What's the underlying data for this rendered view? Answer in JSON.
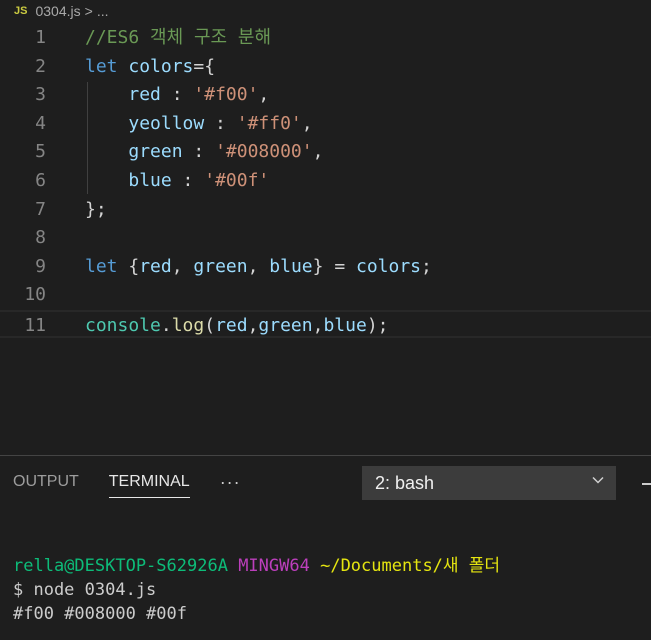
{
  "breadcrumb": {
    "file_icon": "JS",
    "file": "0304.js",
    "separator": ">",
    "ellipsis": "..."
  },
  "editor": {
    "line_numbers": [
      "1",
      "2",
      "3",
      "4",
      "5",
      "6",
      "7",
      "8",
      "9",
      "10",
      "11"
    ],
    "lines": [
      [
        {
          "t": "//ES6 객체 구조 분해",
          "c": "comment"
        }
      ],
      [
        {
          "t": "let",
          "c": "kw"
        },
        {
          "t": " ",
          "c": "punc"
        },
        {
          "t": "colors",
          "c": "var"
        },
        {
          "t": "={",
          "c": "punc"
        }
      ],
      [
        {
          "t": "    ",
          "c": "punc"
        },
        {
          "t": "red",
          "c": "prop"
        },
        {
          "t": " : ",
          "c": "punc"
        },
        {
          "t": "'#f00'",
          "c": "str"
        },
        {
          "t": ",",
          "c": "punc"
        }
      ],
      [
        {
          "t": "    ",
          "c": "punc"
        },
        {
          "t": "yeollow",
          "c": "prop"
        },
        {
          "t": " : ",
          "c": "punc"
        },
        {
          "t": "'#ff0'",
          "c": "str"
        },
        {
          "t": ",",
          "c": "punc"
        }
      ],
      [
        {
          "t": "    ",
          "c": "punc"
        },
        {
          "t": "green",
          "c": "prop"
        },
        {
          "t": " : ",
          "c": "punc"
        },
        {
          "t": "'#008000'",
          "c": "str"
        },
        {
          "t": ",",
          "c": "punc"
        }
      ],
      [
        {
          "t": "    ",
          "c": "punc"
        },
        {
          "t": "blue",
          "c": "prop"
        },
        {
          "t": " : ",
          "c": "punc"
        },
        {
          "t": "'#00f'",
          "c": "str"
        }
      ],
      [
        {
          "t": "};",
          "c": "punc"
        }
      ],
      [],
      [
        {
          "t": "let",
          "c": "kw"
        },
        {
          "t": " {",
          "c": "punc"
        },
        {
          "t": "red",
          "c": "var"
        },
        {
          "t": ", ",
          "c": "punc"
        },
        {
          "t": "green",
          "c": "var"
        },
        {
          "t": ", ",
          "c": "punc"
        },
        {
          "t": "blue",
          "c": "var"
        },
        {
          "t": "} = ",
          "c": "punc"
        },
        {
          "t": "colors",
          "c": "var"
        },
        {
          "t": ";",
          "c": "punc"
        }
      ],
      [],
      [
        {
          "t": "console",
          "c": "obj"
        },
        {
          "t": ".",
          "c": "punc"
        },
        {
          "t": "log",
          "c": "fn"
        },
        {
          "t": "(",
          "c": "punc"
        },
        {
          "t": "red",
          "c": "var"
        },
        {
          "t": ",",
          "c": "punc"
        },
        {
          "t": "green",
          "c": "var"
        },
        {
          "t": ",",
          "c": "punc"
        },
        {
          "t": "blue",
          "c": "var"
        },
        {
          "t": ");",
          "c": "punc"
        }
      ]
    ]
  },
  "panel": {
    "tabs": [
      "OUTPUT",
      "TERMINAL"
    ],
    "active_tab": "TERMINAL",
    "more": "···",
    "terminal_select": "2: bash"
  },
  "terminal": {
    "user": "rella@DESKTOP-S62926A",
    "env": "MINGW64",
    "path_prefix": "~/Documents/",
    "path_folder": "새 폴더",
    "command": "$ node 0304.js",
    "output": "#f00 #008000 #00f"
  },
  "colors": {
    "background": "#1e1e1e",
    "keyword": "#569cd6",
    "string": "#ce9178",
    "comment": "#6a9955"
  }
}
